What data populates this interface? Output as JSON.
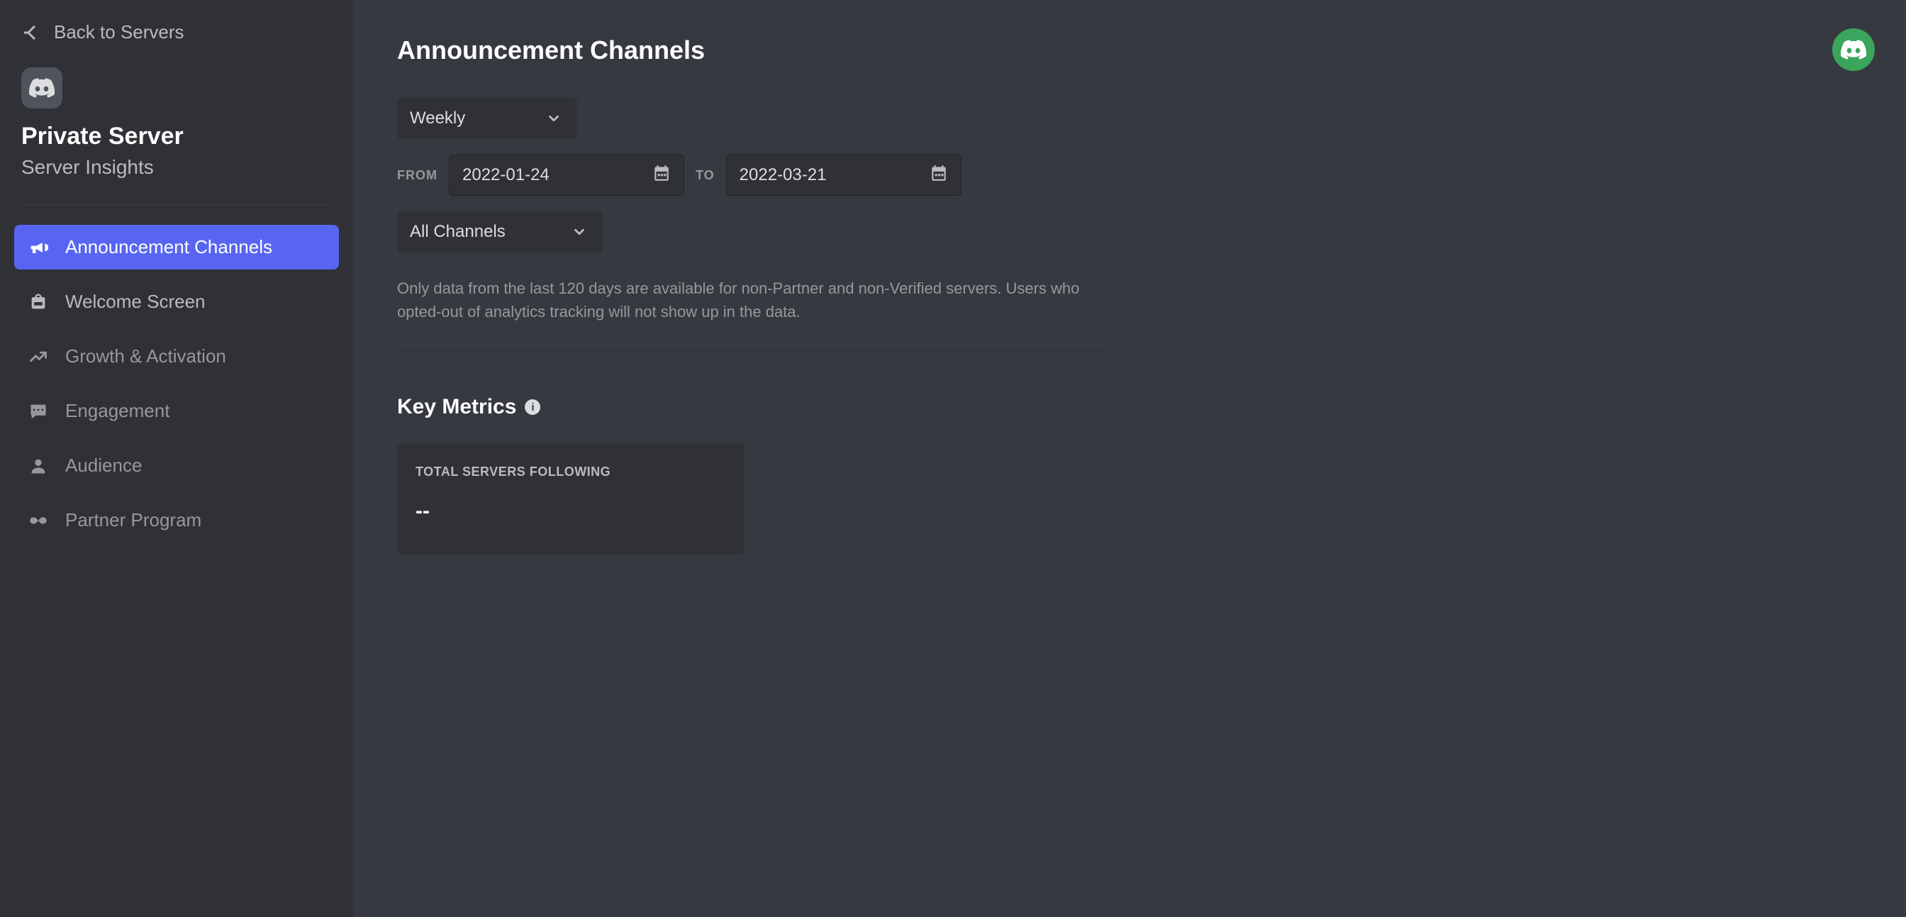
{
  "sidebar": {
    "back_label": "Back to Servers",
    "server_name": "Private Server",
    "server_sub": "Server Insights",
    "items": [
      {
        "label": "Announcement Channels"
      },
      {
        "label": "Welcome Screen"
      },
      {
        "label": "Growth & Activation"
      },
      {
        "label": "Engagement"
      },
      {
        "label": "Audience"
      },
      {
        "label": "Partner Program"
      }
    ]
  },
  "main": {
    "title": "Announcement Channels",
    "interval_select": "Weekly",
    "from_label": "FROM",
    "from_value": "2022-01-24",
    "to_label": "TO",
    "to_value": "2022-03-21",
    "channel_select": "All Channels",
    "info_text": "Only data from the last 120 days are available for non-Partner and non-Verified servers. Users who opted-out of analytics tracking will not show up in the data.",
    "key_metrics_title": "Key Metrics",
    "metric_label": "TOTAL SERVERS FOLLOWING",
    "metric_value": "--"
  }
}
